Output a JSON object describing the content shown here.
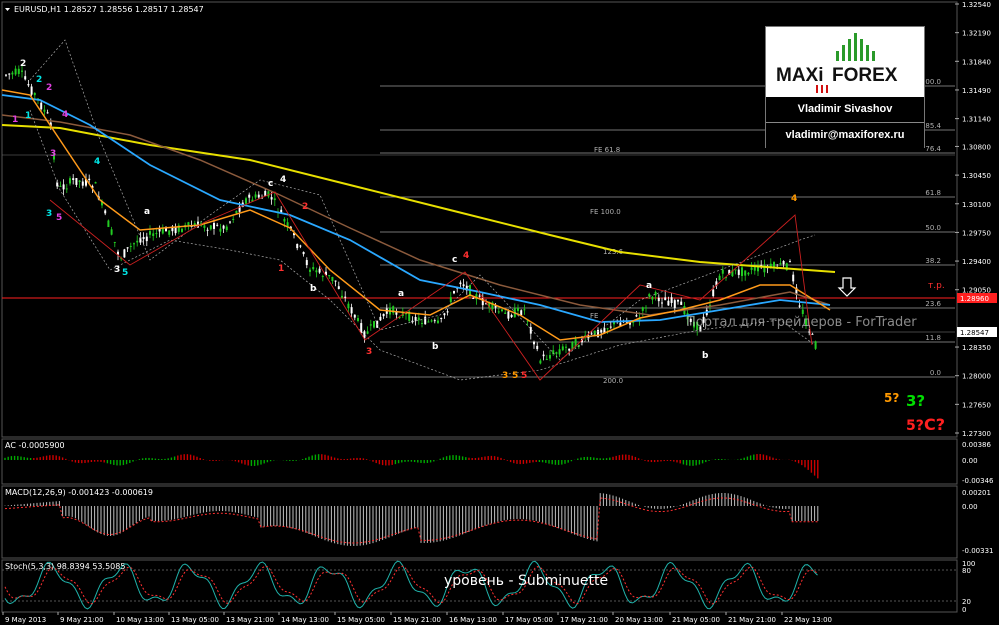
{
  "window": {
    "title": "EURUSD,H1  1.28527 1.28556 1.28517 1.28547"
  },
  "price_axis": {
    "labels": [
      "1.32540",
      "1.32190",
      "1.31840",
      "1.31490",
      "1.31140",
      "1.30800",
      "1.30450",
      "1.30100",
      "1.29750",
      "1.29400",
      "1.29050",
      "1.28960",
      "1.28547",
      "1.28350",
      "1.28000",
      "1.27650",
      "1.27300"
    ],
    "current_price": "1.28547",
    "tp_price": "1.28960"
  },
  "fib_levels": [
    {
      "label": "100.0"
    },
    {
      "label": "85.4"
    },
    {
      "label": "76.4"
    },
    {
      "label": "61.8"
    },
    {
      "label": "50.0"
    },
    {
      "label": "38.2"
    },
    {
      "label": "23.6"
    },
    {
      "label": "11.8"
    },
    {
      "label": "0.0"
    }
  ],
  "fe_levels": [
    {
      "label": "FE 61.8"
    },
    {
      "label": "FE 100.0"
    },
    {
      "label": "123.6"
    },
    {
      "label": "FE"
    },
    {
      "label": "200.0"
    }
  ],
  "annotations": {
    "tp_label": "т.р.",
    "arrow": "down-arrow-icon"
  },
  "wave_labels": [
    {
      "text": "2",
      "color": "#ffffff"
    },
    {
      "text": "2",
      "color": "#00e5e5"
    },
    {
      "text": "2",
      "color": "#e040e0"
    },
    {
      "text": "1",
      "color": "#00e5e5"
    },
    {
      "text": "1",
      "color": "#e040e0"
    },
    {
      "text": "4",
      "color": "#e040e0"
    },
    {
      "text": "4",
      "color": "#00e5e5"
    },
    {
      "text": "3",
      "color": "#e040e0"
    },
    {
      "text": "3",
      "color": "#00e5e5"
    },
    {
      "text": "5",
      "color": "#e040e0"
    },
    {
      "text": "a",
      "color": "#ffffff"
    },
    {
      "text": "3",
      "color": "#ffffff"
    },
    {
      "text": "5",
      "color": "#00e5e5"
    },
    {
      "text": "c",
      "color": "#ffffff"
    },
    {
      "text": "4",
      "color": "#ffffff"
    },
    {
      "text": "2",
      "color": "#ff3030"
    },
    {
      "text": "1",
      "color": "#ff3030"
    },
    {
      "text": "b",
      "color": "#ffffff"
    },
    {
      "text": "a",
      "color": "#ffffff"
    },
    {
      "text": "3",
      "color": "#ff3030"
    },
    {
      "text": "b",
      "color": "#ffffff"
    },
    {
      "text": "c",
      "color": "#ffffff"
    },
    {
      "text": "4",
      "color": "#ff3030"
    },
    {
      "text": "3",
      "color": "#ff9900"
    },
    {
      "text": "5",
      "color": "#ff9900"
    },
    {
      "text": "5",
      "color": "#ff3030"
    },
    {
      "text": "a",
      "color": "#ffffff"
    },
    {
      "text": "b",
      "color": "#ffffff"
    },
    {
      "text": "4",
      "color": "#ff9900"
    }
  ],
  "forecast_labels": [
    {
      "text": "5?",
      "color": "#ff9900"
    },
    {
      "text": "3?",
      "color": "#00dd00"
    },
    {
      "text": "5?",
      "color": "#ff2020"
    },
    {
      "text": "C?",
      "color": "#ff2020"
    }
  ],
  "logo": {
    "brand_left": "MAXi",
    "brand_right": "FOREX",
    "name": "Vladimir Sivashov",
    "email": "vladimir@maxiforex.ru",
    "accent_green": "#2a9a2a",
    "accent_red": "#d01010"
  },
  "watermark": "Портал для трейдеров - ForTrader",
  "subtitle": "уровень - Subminuette",
  "indicators": {
    "ac": {
      "title": "AC -0.0005900",
      "labels": [
        "0.00386",
        "0.00",
        "-0.00346"
      ]
    },
    "macd": {
      "title": "MACD(12,26,9) -0.001423 -0.000619",
      "labels": [
        "0.00201",
        "0.00",
        "-0.00331"
      ]
    },
    "stoch": {
      "title": "Stoch(5,3,3) 98.8394 53.5085",
      "labels": [
        "100",
        "80",
        "20",
        "0"
      ]
    }
  },
  "time_axis": [
    "9 May 2013",
    "9 May 21:00",
    "10 May 13:00",
    "13 May 05:00",
    "13 May 21:00",
    "14 May 13:00",
    "15 May 05:00",
    "15 May 21:00",
    "16 May 13:00",
    "17 May 05:00",
    "17 May 21:00",
    "20 May 13:00",
    "21 May 05:00",
    "21 May 21:00",
    "22 May 13:00"
  ],
  "colors": {
    "background": "#000000",
    "grid": "#3a3a3a",
    "bull_candle": "#22cc22",
    "bear_candle": "#ffffff",
    "ma_slow": "#e8e000",
    "ma_brown": "#8b5a3c",
    "ma_blue": "#2aa8ff",
    "ma_orange": "#ff9a1a",
    "tp_line": "#ff2020",
    "stoch_main": "#20b2aa",
    "stoch_signal": "#ff3030",
    "macd_signal": "#ff3030",
    "macd_hist": "#c0c0c0",
    "ac_up": "#00aa00",
    "ac_down": "#cc0000"
  }
}
